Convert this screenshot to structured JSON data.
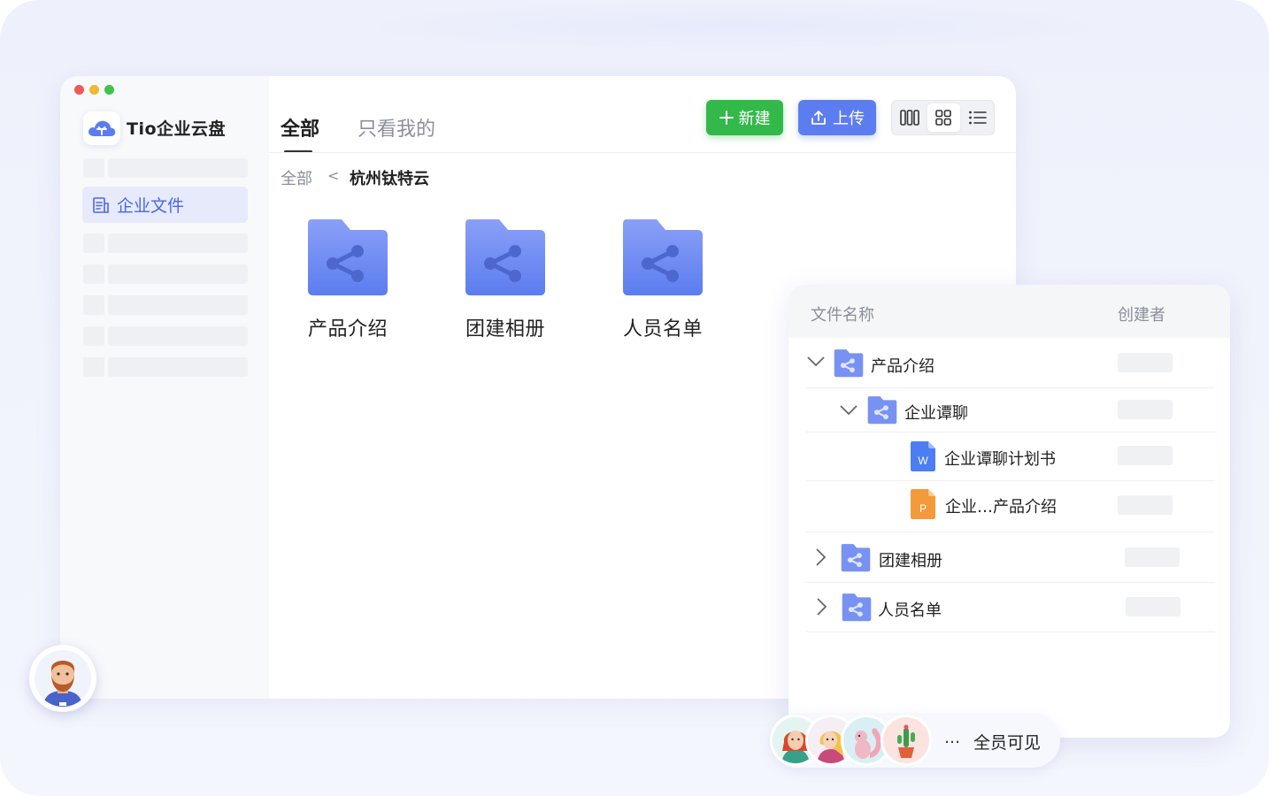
{
  "app": {
    "name": "Tio企业云盘"
  },
  "sidebar": {
    "active_item": {
      "label": "企业文件",
      "icon": "document-icon"
    }
  },
  "tabs": [
    {
      "label": "全部",
      "active": true
    },
    {
      "label": "只看我的",
      "active": false
    }
  ],
  "toolbar": {
    "new_label": "新建",
    "upload_label": "上传",
    "views": [
      "column-view-icon",
      "grid-view-icon",
      "list-view-icon"
    ],
    "selected_view": "grid-view-icon"
  },
  "breadcrumb": {
    "root": "全部",
    "separator": "<",
    "current": "杭州钛特云"
  },
  "folders": [
    {
      "label": "产品介绍"
    },
    {
      "label": "团建相册"
    },
    {
      "label": "人员名单"
    }
  ],
  "file_panel": {
    "columns": {
      "name": "文件名称",
      "creator": "创建者"
    },
    "rows": [
      {
        "name": "产品介绍",
        "type": "shared-folder",
        "expanded": true
      },
      {
        "name": "企业谭聊",
        "type": "shared-folder",
        "expanded": true
      },
      {
        "name": "企业谭聊计划书",
        "type": "word-file",
        "badge": "W"
      },
      {
        "name": "企业…产品介绍",
        "type": "ppt-file",
        "badge": "P"
      },
      {
        "name": "团建相册",
        "type": "shared-folder",
        "expanded": false
      },
      {
        "name": "人员名单",
        "type": "shared-folder",
        "expanded": false
      }
    ]
  },
  "visibility": {
    "more": "…",
    "label": "全员可见"
  },
  "colors": {
    "accent": "#5c7df0",
    "new_button": "#33b84a",
    "folder": "#6d8bf2"
  }
}
